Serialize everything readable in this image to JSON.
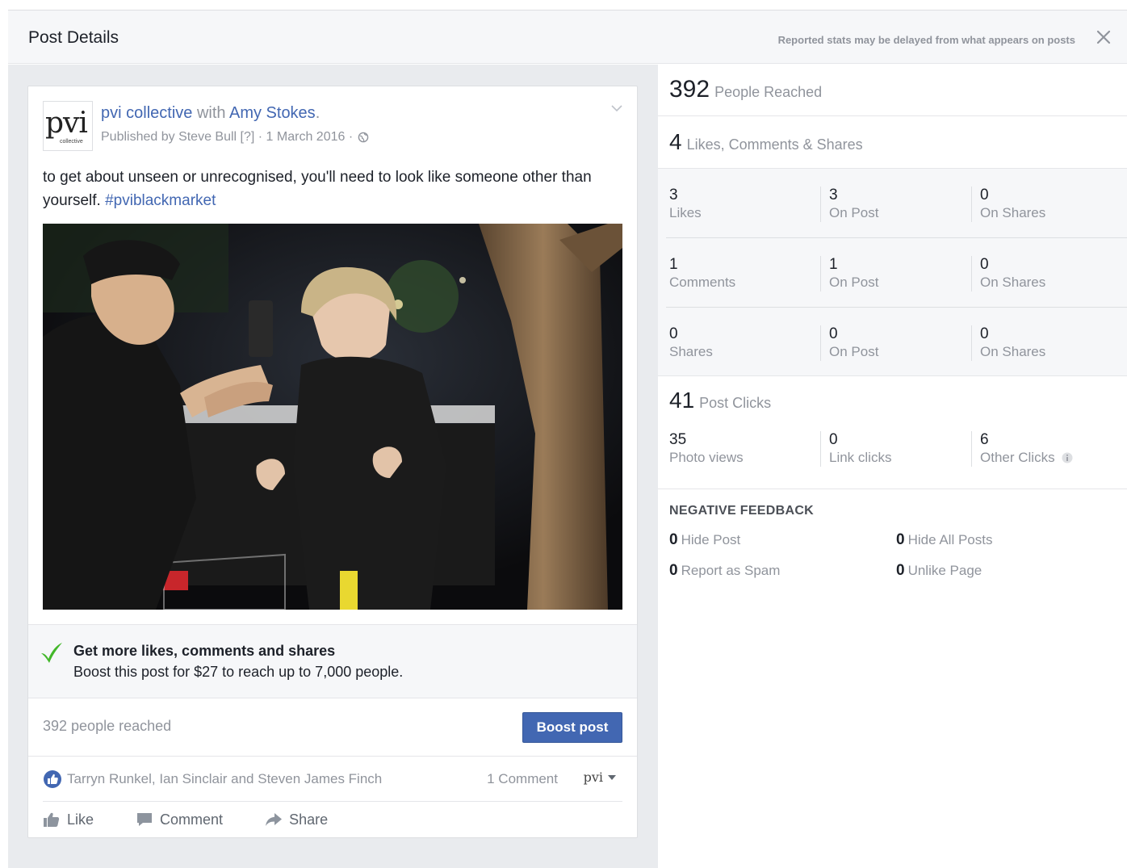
{
  "header": {
    "title": "Post Details",
    "note": "Reported stats may be delayed from what appears on posts"
  },
  "post": {
    "avatar_text": "pvi",
    "avatar_subtext": "collective",
    "page_name": "pvi collective",
    "with_word": "with",
    "tagged": "Amy Stokes",
    "tagged_suffix": ".",
    "meta": "Published by Steve Bull [?] · 1 March 2016 ·",
    "text": "to get about unseen or unrecognised, you'll need to look like someone other than yourself.",
    "hashtag": "#pviblackmarket"
  },
  "boost": {
    "title": "Get more likes, comments and shares",
    "subtitle": "Boost this post for $27 to reach up to 7,000 people.",
    "reached": "392 people reached",
    "button": "Boost post"
  },
  "reactions": {
    "names": "Tarryn Runkel, Ian Sinclair and Steven James Finch",
    "comments": "1 Comment",
    "page_selector": "pvi"
  },
  "actions": {
    "like": "Like",
    "comment": "Comment",
    "share": "Share"
  },
  "stats": {
    "reached": {
      "value": "392",
      "label": "People Reached"
    },
    "engagement": {
      "value": "4",
      "label": "Likes, Comments & Shares"
    },
    "rows": [
      {
        "cells": [
          {
            "value": "3",
            "label": "Likes"
          },
          {
            "value": "3",
            "label": "On Post"
          },
          {
            "value": "0",
            "label": "On Shares"
          }
        ]
      },
      {
        "cells": [
          {
            "value": "1",
            "label": "Comments"
          },
          {
            "value": "1",
            "label": "On Post"
          },
          {
            "value": "0",
            "label": "On Shares"
          }
        ]
      },
      {
        "cells": [
          {
            "value": "0",
            "label": "Shares"
          },
          {
            "value": "0",
            "label": "On Post"
          },
          {
            "value": "0",
            "label": "On Shares"
          }
        ]
      }
    ],
    "clicks": {
      "value": "41",
      "label": "Post Clicks",
      "cells": [
        {
          "value": "35",
          "label": "Photo views"
        },
        {
          "value": "0",
          "label": "Link clicks"
        },
        {
          "value": "6",
          "label": "Other Clicks"
        }
      ]
    },
    "negative": {
      "title": "NEGATIVE FEEDBACK",
      "items": [
        {
          "value": "0",
          "label": "Hide Post"
        },
        {
          "value": "0",
          "label": "Hide All Posts"
        },
        {
          "value": "0",
          "label": "Report as Spam"
        },
        {
          "value": "0",
          "label": "Unlike Page"
        }
      ]
    }
  },
  "colors": {
    "brand_blue": "#4267b2",
    "boost_check": "#42b72a",
    "muted_text": "#90949c"
  }
}
